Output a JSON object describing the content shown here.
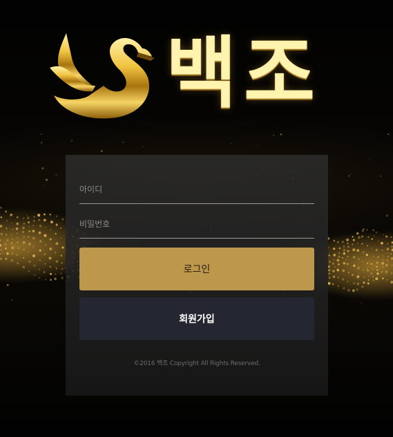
{
  "brand": {
    "logo_text": "백조",
    "gold_color": "#d8ac2c"
  },
  "login_form": {
    "id_placeholder": "아이디",
    "id_value": "",
    "password_placeholder": "비밀번호",
    "password_value": "",
    "login_label": "로그인",
    "signup_label": "회원가입",
    "login_color": "#bc974c",
    "signup_color": "#242732"
  },
  "footer": {
    "copyright": "©2016 백조 Copyright All Rights Reserved."
  },
  "icons": {
    "logo_mark": "swan-icon"
  }
}
